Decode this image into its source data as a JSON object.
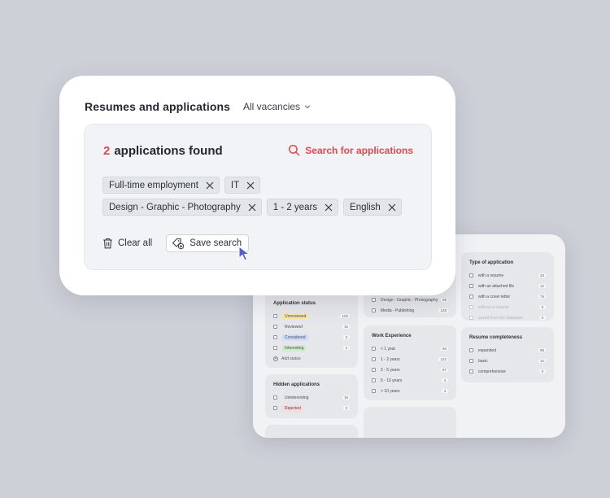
{
  "header": {
    "title": "Resumes and applications",
    "vacancies_label": "All vacancies"
  },
  "results": {
    "count": "2",
    "label": "applications found"
  },
  "search_link": "Search for applications",
  "chips": [
    [
      "Full-time employment",
      "IT"
    ],
    [
      "Design - Graphic - Photography",
      "1 - 2 years",
      "English"
    ]
  ],
  "actions": {
    "clear_all": "Clear all",
    "save_search": "Save search"
  },
  "colors": {
    "accent": "#e5484d",
    "unreviewed": "#fbe8a6",
    "considered": "#cfdcfb",
    "interesting": "#cdeec9",
    "rejected": "#fbdada"
  },
  "back_panel": {
    "application_status": {
      "title": "Application status",
      "items": [
        {
          "label": "Unreviewed",
          "count": "102"
        },
        {
          "label": "Reviewed",
          "count": "16"
        },
        {
          "label": "Considered",
          "count": "3"
        },
        {
          "label": "Interesting",
          "count": "2"
        }
      ],
      "add_status": "Add status"
    },
    "hidden_applications": {
      "title": "Hidden applications",
      "items": [
        {
          "label": "Uninteresting",
          "count": "16"
        },
        {
          "label": "Rejected",
          "count": "2"
        }
      ]
    },
    "industry": {
      "items": [
        {
          "label": "Design - Graphic - Photography",
          "count": "69"
        },
        {
          "label": "Media - Publishing",
          "count": "126"
        }
      ]
    },
    "work_experience": {
      "title": "Work Experience",
      "items": [
        {
          "label": "< 1 year",
          "count": "69"
        },
        {
          "label": "1 - 2 years",
          "count": "122"
        },
        {
          "label": "2 - 5 years",
          "count": "87"
        },
        {
          "label": "5 - 10 years",
          "count": "4"
        },
        {
          "label": "> 10 years",
          "count": "4"
        }
      ]
    },
    "type_of_application": {
      "title": "Type of application",
      "items": [
        {
          "label": "with a resume",
          "count": "33"
        },
        {
          "label": "with an attached file",
          "count": "12"
        },
        {
          "label": "with a cover letter",
          "count": "76"
        },
        {
          "label": "without a resume",
          "count": "0"
        },
        {
          "label": "saved from the database",
          "count": "0"
        }
      ]
    },
    "resume_completeness": {
      "title": "Resume completeness",
      "items": [
        {
          "label": "expanded",
          "count": "95"
        },
        {
          "label": "basic",
          "count": "12"
        },
        {
          "label": "comprehensive",
          "count": "0"
        }
      ]
    }
  }
}
